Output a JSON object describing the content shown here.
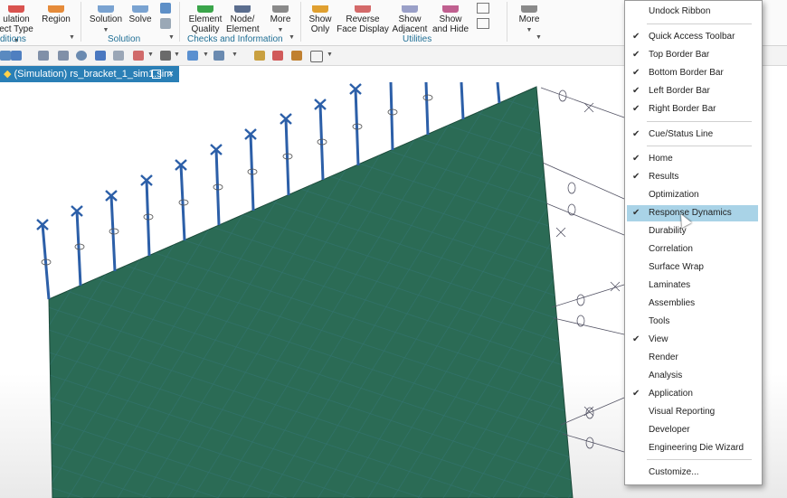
{
  "ribbon": {
    "buttons": {
      "simulation": "ulation",
      "object_type": "ect Type",
      "region": "Region",
      "solution": "Solution",
      "solve": "Solve",
      "element_quality": "Element Quality",
      "node_element": "Node/ Element",
      "more_checks": "More",
      "show_only": "Show Only",
      "reverse_face_display": "Reverse Face Display",
      "show_adjacent": "Show Adjacent",
      "show_and_hide": "Show and Hide",
      "more_utilities": "More"
    },
    "groups": {
      "conditions": "ditions",
      "solution": "Solution",
      "checks": "Checks and Information",
      "utilities": "Utilities"
    }
  },
  "document_tab": {
    "title": "(Simulation) rs_bracket_1_sim1.sim",
    "close": "×"
  },
  "context_menu": {
    "items": [
      {
        "label": "Undock Ribbon",
        "checked": false
      },
      {
        "label": "Quick Access Toolbar",
        "checked": true
      },
      {
        "label": "Top Border Bar",
        "checked": true
      },
      {
        "label": "Bottom Border Bar",
        "checked": true
      },
      {
        "label": "Left Border Bar",
        "checked": true
      },
      {
        "label": "Right Border Bar",
        "checked": true
      },
      {
        "label": "Cue/Status Line",
        "checked": true
      },
      {
        "label": "Home",
        "checked": true
      },
      {
        "label": "Results",
        "checked": true
      },
      {
        "label": "Optimization",
        "checked": false
      },
      {
        "label": "Response Dynamics",
        "checked": true,
        "highlighted": true
      },
      {
        "label": "Durability",
        "checked": false
      },
      {
        "label": "Correlation",
        "checked": false
      },
      {
        "label": "Surface Wrap",
        "checked": false
      },
      {
        "label": "Laminates",
        "checked": false
      },
      {
        "label": "Assemblies",
        "checked": false
      },
      {
        "label": "Tools",
        "checked": false
      },
      {
        "label": "View",
        "checked": true
      },
      {
        "label": "Render",
        "checked": false
      },
      {
        "label": "Analysis",
        "checked": false
      },
      {
        "label": "Application",
        "checked": true
      },
      {
        "label": "Visual Reporting",
        "checked": false
      },
      {
        "label": "Developer",
        "checked": false
      },
      {
        "label": "Engineering Die Wizard",
        "checked": false
      },
      {
        "label": "Customize...",
        "checked": false
      }
    ],
    "check_glyph": "✔"
  },
  "colors": {
    "accent": "#2a7fb6",
    "highlight": "#a9d3e7",
    "mesh_face": "#2b6b55",
    "constraint_symbol": "#2c5fa8",
    "group_label": "#1f6f95"
  }
}
